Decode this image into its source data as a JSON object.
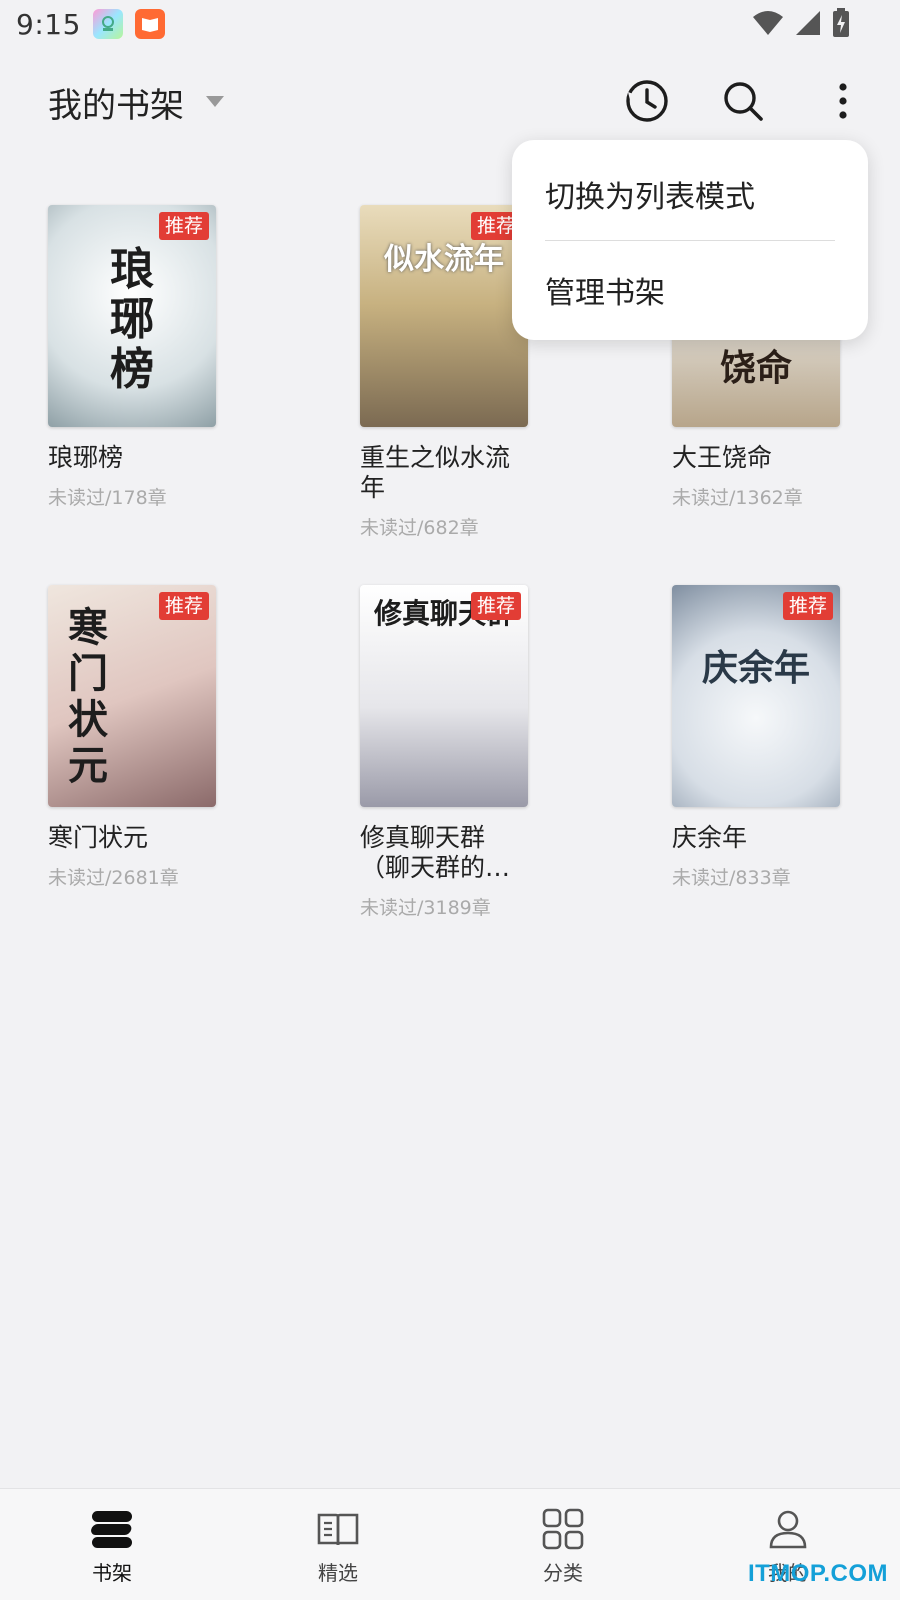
{
  "status_bar": {
    "time": "9:15"
  },
  "header": {
    "title": "我的书架"
  },
  "menu": {
    "items": [
      {
        "label": "切换为列表模式"
      },
      {
        "label": "管理书架"
      }
    ]
  },
  "books": [
    {
      "title": "琅琊榜",
      "progress": "未读过/178章",
      "badge": "推荐",
      "cover_text": "琅琊榜",
      "cover_color": "#e9eef0"
    },
    {
      "title": "重生之似水流年",
      "progress": "未读过/682章",
      "badge": "推荐",
      "cover_text": "似水流年",
      "cover_color": "#c9b68d"
    },
    {
      "title": "大王饶命",
      "progress": "未读过/1362章",
      "badge": "",
      "cover_text": "饶命",
      "cover_color": "#d9d2c6"
    },
    {
      "title": "寒门状元",
      "progress": "未读过/2681章",
      "badge": "推荐",
      "cover_text": "寒门状元",
      "cover_color": "#e8d6cf"
    },
    {
      "title": "修真聊天群（聊天群的…",
      "progress": "未读过/3189章",
      "badge": "推荐",
      "cover_text": "修真聊天群",
      "cover_color": "#e6e6ea"
    },
    {
      "title": "庆余年",
      "progress": "未读过/833章",
      "badge": "推荐",
      "cover_text": "庆余年",
      "cover_color": "#d7dee6"
    }
  ],
  "bottom_nav": [
    {
      "label": "书架",
      "icon": "bookshelf-icon",
      "active": true
    },
    {
      "label": "精选",
      "icon": "open-book-icon",
      "active": false
    },
    {
      "label": "分类",
      "icon": "grid-icon",
      "active": false
    },
    {
      "label": "我的",
      "icon": "person-icon",
      "active": false
    }
  ],
  "watermark": "ITMOP.COM",
  "colors": {
    "badge": "#e23d35",
    "watermark": "#14a0d8"
  }
}
